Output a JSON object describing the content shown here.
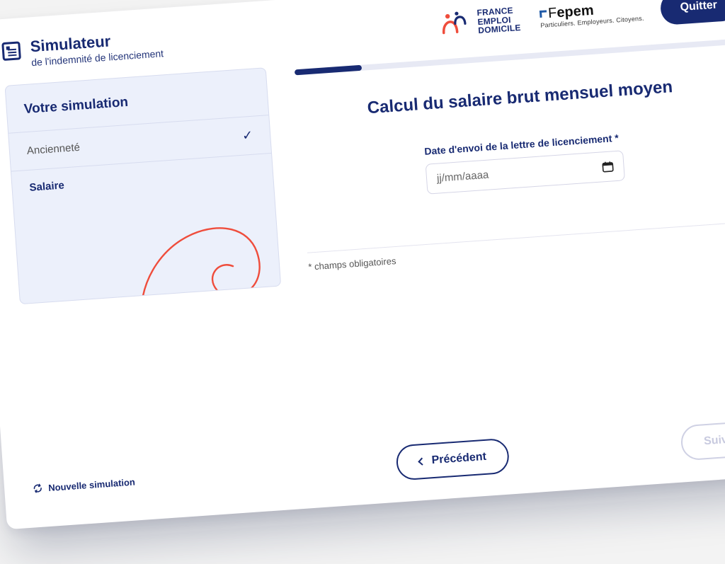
{
  "header": {
    "title": "Simulateur",
    "subtitle": "de l'indemnité de licenciement",
    "logo_fed_line1": "FRANCE",
    "logo_fed_line2": "EMPLOI",
    "logo_fed_line3": "DOMICILE",
    "logo_fepem_name_light": "F",
    "logo_fepem_name_bold": "epem",
    "logo_fepem_sub": "Particuliers. Employeurs. Citoyens.",
    "quit_label": "Quitter"
  },
  "sidebar": {
    "panel_title": "Votre simulation",
    "steps": [
      {
        "label": "Ancienneté",
        "done": true
      },
      {
        "label": "Salaire",
        "active": true
      }
    ]
  },
  "main": {
    "progress_percent": 15,
    "heading": "Calcul du salaire brut mensuel moyen",
    "field_label": "Date d'envoi de la lettre de licenciement",
    "required_mark": "*",
    "date_placeholder": "jj/mm/aaaa",
    "mandatory_note": "* champs obligatoires"
  },
  "footer": {
    "reset_label": "Nouvelle simulation",
    "prev_label": "Précédent",
    "next_label": "Suivant"
  }
}
